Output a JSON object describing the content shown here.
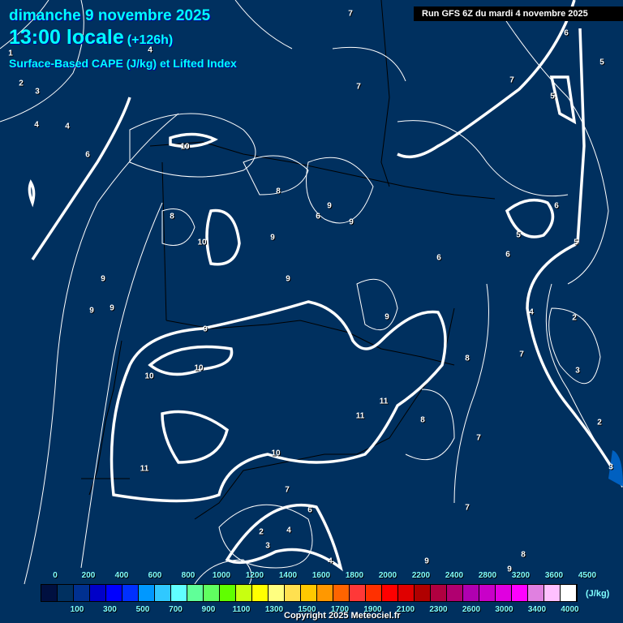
{
  "header": {
    "date": "dimanche 9 novembre 2025",
    "time": "13:00 locale",
    "lead": "(+126h)",
    "field": "Surface-Based CAPE (J/kg) et Lifted Index",
    "run": "Run GFS 6Z du mardi 4 novembre 2025"
  },
  "contour_labels": [
    "7",
    "4",
    "1",
    "2",
    "3",
    "4",
    "4",
    "6",
    "7",
    "7",
    "6",
    "5",
    "5",
    "10",
    "8",
    "10",
    "9",
    "8",
    "6",
    "9",
    "9",
    "9",
    "6",
    "9",
    "9",
    "9",
    "10",
    "10",
    "9",
    "9",
    "11",
    "11",
    "11",
    "7",
    "10",
    "2",
    "4",
    "3",
    "8",
    "7",
    "6",
    "4",
    "2",
    "3",
    "2",
    "3",
    "8",
    "7",
    "4",
    "9",
    "9",
    "8",
    "7",
    "6",
    "6",
    "5",
    "5"
  ],
  "legend": {
    "colors": [
      "#001040",
      "#003060",
      "#003090",
      "#0000c8",
      "#0000ff",
      "#0030ff",
      "#0098ff",
      "#30c8ff",
      "#60ffff",
      "#60ff98",
      "#60ff60",
      "#60ff00",
      "#c8ff10",
      "#ffff00",
      "#ffff80",
      "#ffe050",
      "#ffc800",
      "#ff9800",
      "#ff6400",
      "#ff3838",
      "#ff3000",
      "#ff0000",
      "#e00000",
      "#b00000",
      "#b00040",
      "#b00070",
      "#b000b0",
      "#c800c8",
      "#e000e0",
      "#ff00ff",
      "#e080e0",
      "#ffc0ff",
      "#ffffff"
    ],
    "top_labels": [
      "0",
      "200",
      "400",
      "600",
      "800",
      "1000",
      "1200",
      "1400",
      "1600",
      "1800",
      "2000",
      "2200",
      "2400",
      "2800",
      "3200",
      "3600",
      "4500"
    ],
    "bottom_labels": [
      "100",
      "300",
      "500",
      "700",
      "900",
      "1100",
      "1300",
      "1500",
      "1700",
      "1900",
      "2100",
      "2300",
      "2600",
      "3000",
      "3400",
      "4000"
    ],
    "unit": "(J/kg)"
  },
  "copyright": "Copyright 2025 Meteociel.fr"
}
